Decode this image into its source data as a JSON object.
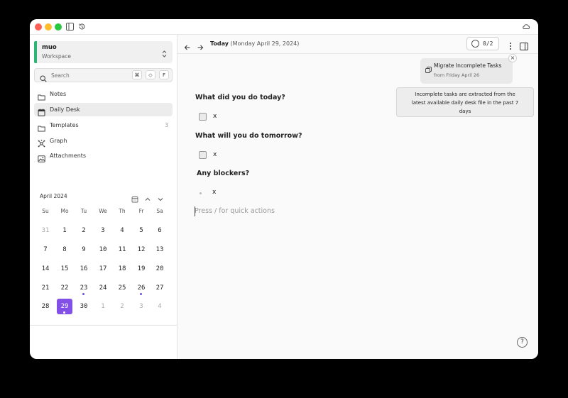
{
  "workspace": {
    "name": "muo",
    "label": "Workspace"
  },
  "search": {
    "placeholder": "Search",
    "keys": [
      "⌘",
      "◇",
      "F"
    ]
  },
  "nav": [
    {
      "label": "Notes",
      "icon": "folder-icon"
    },
    {
      "label": "Daily Desk",
      "icon": "calendar-icon",
      "active": true
    },
    {
      "label": "Templates",
      "icon": "folder-icon",
      "count": "3"
    },
    {
      "label": "Graph",
      "icon": "graph-icon"
    },
    {
      "label": "Attachments",
      "icon": "image-icon"
    }
  ],
  "calendar": {
    "month_label": "April 2024",
    "weekdays": [
      "Su",
      "Mo",
      "Tu",
      "We",
      "Th",
      "Fr",
      "Sa"
    ],
    "weeks": [
      [
        "31",
        "1",
        "2",
        "3",
        "4",
        "5",
        "6"
      ],
      [
        "7",
        "8",
        "9",
        "10",
        "11",
        "12",
        "13"
      ],
      [
        "14",
        "15",
        "16",
        "17",
        "18",
        "19",
        "20"
      ],
      [
        "21",
        "22",
        "23",
        "24",
        "25",
        "26",
        "27"
      ],
      [
        "28",
        "29",
        "30",
        "1",
        "2",
        "3",
        "4"
      ]
    ],
    "selected": "29",
    "dotted_days": [
      "23",
      "26",
      "29"
    ]
  },
  "toolbar": {
    "today": "Today",
    "date": "(Monday April 29, 2024)",
    "task_counter": "0/2"
  },
  "migrate": {
    "title": "Migrate Incomplete Tasks",
    "subtitle": "from Friday April 26",
    "tooltip_line1": "Incomplete tasks are extracted from the",
    "tooltip_line2": "latest available daily desk file in the past 7",
    "tooltip_line3": "days"
  },
  "editor": {
    "h1": "What did you do today?",
    "t1": "x",
    "h2": "What will you do tomorrow?",
    "t2": "x",
    "h3": "Any blockers?",
    "t3": "x",
    "placeholder": "Press / for quick actions"
  },
  "colors": {
    "accent": "#8250e6",
    "workspace_bar": "#2bb673"
  }
}
